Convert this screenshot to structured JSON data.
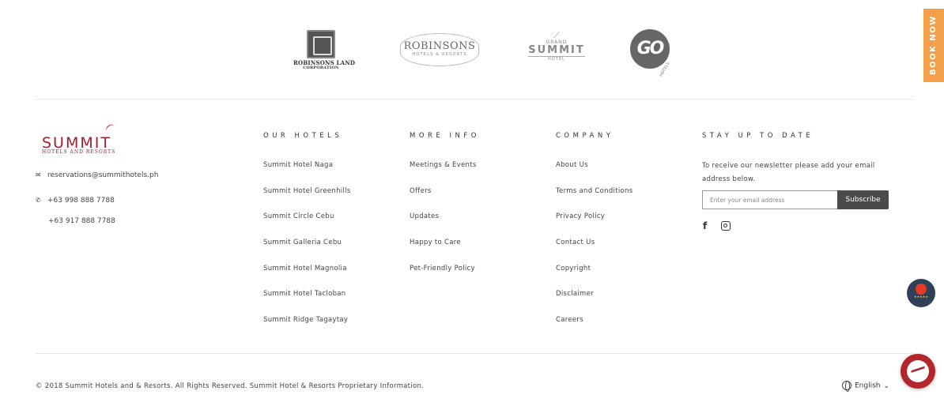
{
  "partners": {
    "rlc": {
      "name": "ROBINSONS LAND",
      "sub": "CORPORATION"
    },
    "robinsons": {
      "name": "ROBINSONS",
      "sub": "HOTELS & RESORTS"
    },
    "grand_summit": {
      "grand": "GRAND",
      "summit": "SUMMIT",
      "hotel": "HOTEL"
    },
    "go": {
      "name": "GO",
      "sub": "HOTELS"
    }
  },
  "brand": {
    "name": "SUMMIT",
    "sub": "HOTELS AND RESORTS",
    "color": "#a81d2d"
  },
  "contact": {
    "email": "reservations@summithotels.ph",
    "phone1": "+63 998 888 7788",
    "phone2": "+63 917 888 7788"
  },
  "columns": {
    "hotels": {
      "title": "OUR HOTELS",
      "links": [
        "Summit Hotel Naga",
        "Summit Hotel Greenhills",
        "Summit Circle Cebu",
        "Summit Galleria Cebu",
        "Summit Hotel Magnolia",
        "Summit Hotel Tacloban",
        "Summit Ridge Tagaytay"
      ]
    },
    "more_info": {
      "title": "MORE INFO",
      "links": [
        "Meetings & Events",
        "Offers",
        "Updates",
        "Happy to Care",
        "Pet-Friendly Policy"
      ]
    },
    "company": {
      "title": "COMPANY",
      "links": [
        "About Us",
        "Terms and Conditions",
        "Privacy Policy",
        "Contact Us",
        "Copyright",
        "Disclaimer",
        "Careers"
      ]
    },
    "newsletter": {
      "title": "STAY UP TO DATE",
      "text": "To receive our newsletter please add your email address below.",
      "placeholder": "Enter your email address",
      "button": "Subscribe"
    }
  },
  "social": [
    "facebook-icon",
    "instagram-icon"
  ],
  "book_now": "BOOK NOW",
  "book_now_color": "#f4a04a",
  "copyright": "© 2018 Summit Hotels and & Resorts. All Rights Reserved. Summit Hotel & Resorts Proprietary Information.",
  "language": "English"
}
